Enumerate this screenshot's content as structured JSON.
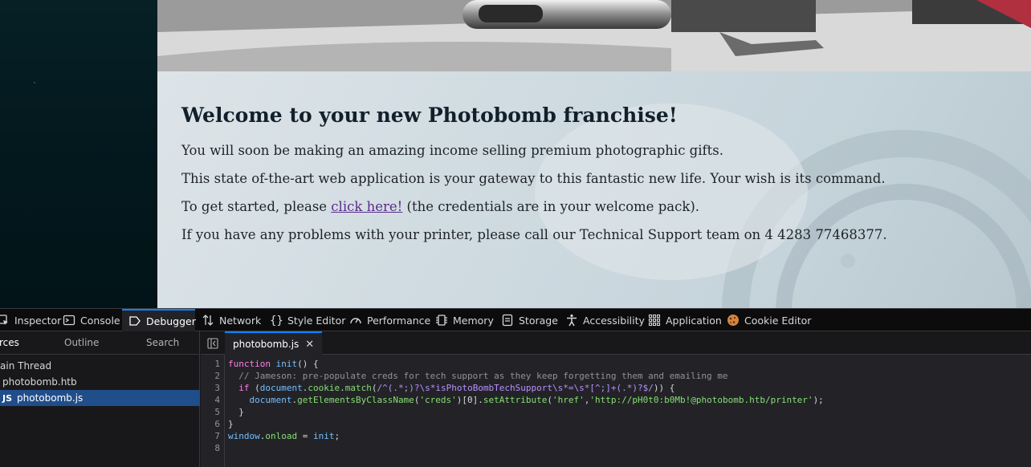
{
  "page": {
    "title": "Welcome to your new Photobomb franchise!",
    "para1": "You will soon be making an amazing income selling premium photographic gifts.",
    "para2": "This state of-the-art web application is your gateway to this fantastic new life. Your wish is its command.",
    "para3_before": "To get started, please ",
    "link_text": "click here!",
    "para3_after": " (the credentials are in your welcome pack).",
    "para4": "If you have any problems with your printer, please call our Technical Support team on 4 4283 77468377."
  },
  "devtools": {
    "tabs": [
      {
        "label": "Inspector",
        "icon": "inspector-icon"
      },
      {
        "label": "Console",
        "icon": "console-icon"
      },
      {
        "label": "Debugger",
        "icon": "debugger-icon",
        "active": true
      },
      {
        "label": "Network",
        "icon": "network-icon"
      },
      {
        "label": "Style Editor",
        "icon": "style-editor-icon"
      },
      {
        "label": "Performance",
        "icon": "performance-icon"
      },
      {
        "label": "Memory",
        "icon": "memory-icon"
      },
      {
        "label": "Storage",
        "icon": "storage-icon"
      },
      {
        "label": "Accessibility",
        "icon": "accessibility-icon"
      },
      {
        "label": "Application",
        "icon": "application-icon"
      },
      {
        "label": "Cookie Editor",
        "icon": "cookie-icon"
      }
    ],
    "sources": {
      "tabs": [
        "rces",
        "Outline",
        "Search"
      ],
      "tree": [
        {
          "label": "ain Thread"
        },
        {
          "label": "photobomb.htb"
        },
        {
          "label": "photobomb.js",
          "badge": "JS",
          "selected": true
        }
      ]
    },
    "editor": {
      "file_tab": "photobomb.js",
      "close": "✕",
      "line_numbers": [
        "1",
        "2",
        "3",
        "4",
        "5",
        "6",
        "7",
        "8"
      ],
      "lines": {
        "l1_kw": "function",
        "l1_fn": "init",
        "l1_rest": "() {",
        "l2_comment": "// Jameson: pre-populate creds for tech support as they keep forgetting them and emailing me",
        "l3_kw": "if",
        "l3_a": " (",
        "l3_obj": "document",
        "l3_b": ".",
        "l3_prop1": "cookie",
        "l3_c": ".",
        "l3_prop2": "match",
        "l3_d": "(",
        "l3_regex": "/^(.*;)?\\s*isPhotoBombTechSupport\\s*=\\s*[^;]+(.*)?$/",
        "l3_e": ")) {",
        "l4_obj": "document",
        "l4_a": ".",
        "l4_prop1": "getElementsByClassName",
        "l4_b": "(",
        "l4_str1": "'creds'",
        "l4_c": ")[0].",
        "l4_prop2": "setAttribute",
        "l4_d": "(",
        "l4_str2": "'href'",
        "l4_e": ",",
        "l4_str3": "'http://pH0t0:b0Mb!@photobomb.htb/printer'",
        "l4_f": ");",
        "l5": "}",
        "l6": "}",
        "l7_obj": "window",
        "l7_a": ".",
        "l7_prop": "onload",
        "l7_b": " = ",
        "l7_fn": "init",
        "l7_c": ";"
      }
    }
  },
  "colors": {
    "accent": "#0a84ff",
    "selected_row": "#204e8a",
    "link": "#5a2a8c"
  }
}
